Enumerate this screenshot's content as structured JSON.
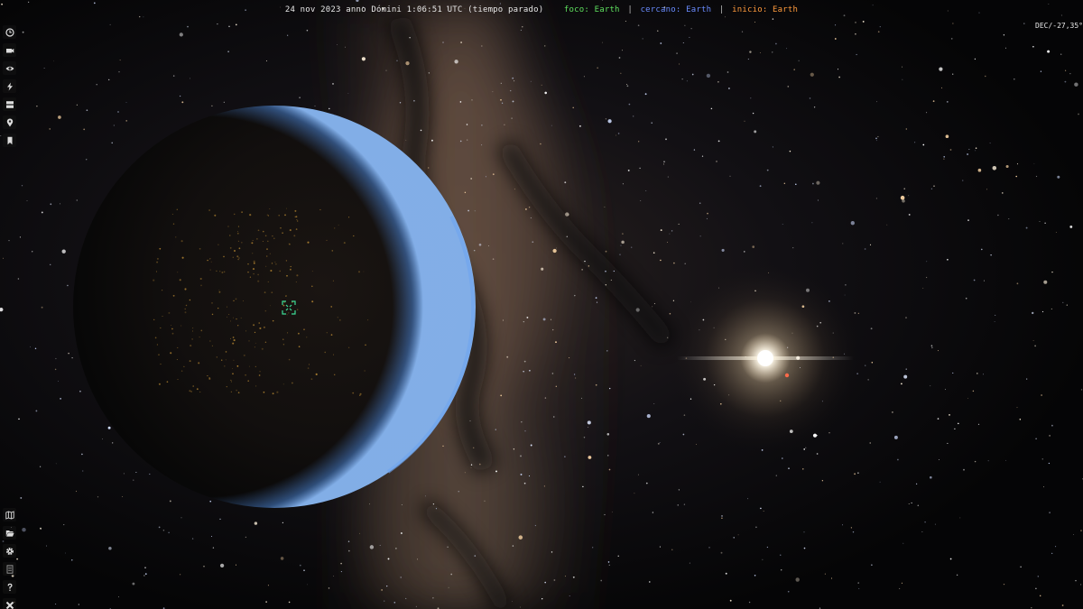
{
  "status_bar": {
    "time": "24 nov 2023 anno Dómini 1:06:51 UTC (tiempo parado)",
    "focus": "foco: Earth",
    "closest": "cercano: Earth",
    "home": "inicio: Earth",
    "separator": "|"
  },
  "dec_readout": "DEC/-27,35°",
  "toolbar_top": [
    {
      "name": "time-button",
      "icon": "clock-icon"
    },
    {
      "name": "camera-button",
      "icon": "camera-icon"
    },
    {
      "name": "visibility-button",
      "icon": "eye-icon"
    },
    {
      "name": "visual-settings-button",
      "icon": "bolt-icon"
    },
    {
      "name": "datasets-button",
      "icon": "layers-icon"
    },
    {
      "name": "location-log-button",
      "icon": "location-pin-icon"
    },
    {
      "name": "bookmarks-button",
      "icon": "bookmark-icon"
    }
  ],
  "toolbar_bottom": [
    {
      "name": "map-button",
      "icon": "map-icon"
    },
    {
      "name": "open-folder-button",
      "icon": "folder-open-icon"
    },
    {
      "name": "settings-button",
      "icon": "gear-icon"
    },
    {
      "name": "log-button",
      "icon": "document-icon"
    },
    {
      "name": "help-button",
      "icon": "question-icon"
    },
    {
      "name": "quit-button",
      "icon": "close-icon"
    }
  ],
  "colors": {
    "time": "#e8e8e8",
    "focus": "#5ee05e",
    "closest": "#6a8cff",
    "home": "#ff9a3c",
    "focus_marker": "#3ddc97"
  }
}
